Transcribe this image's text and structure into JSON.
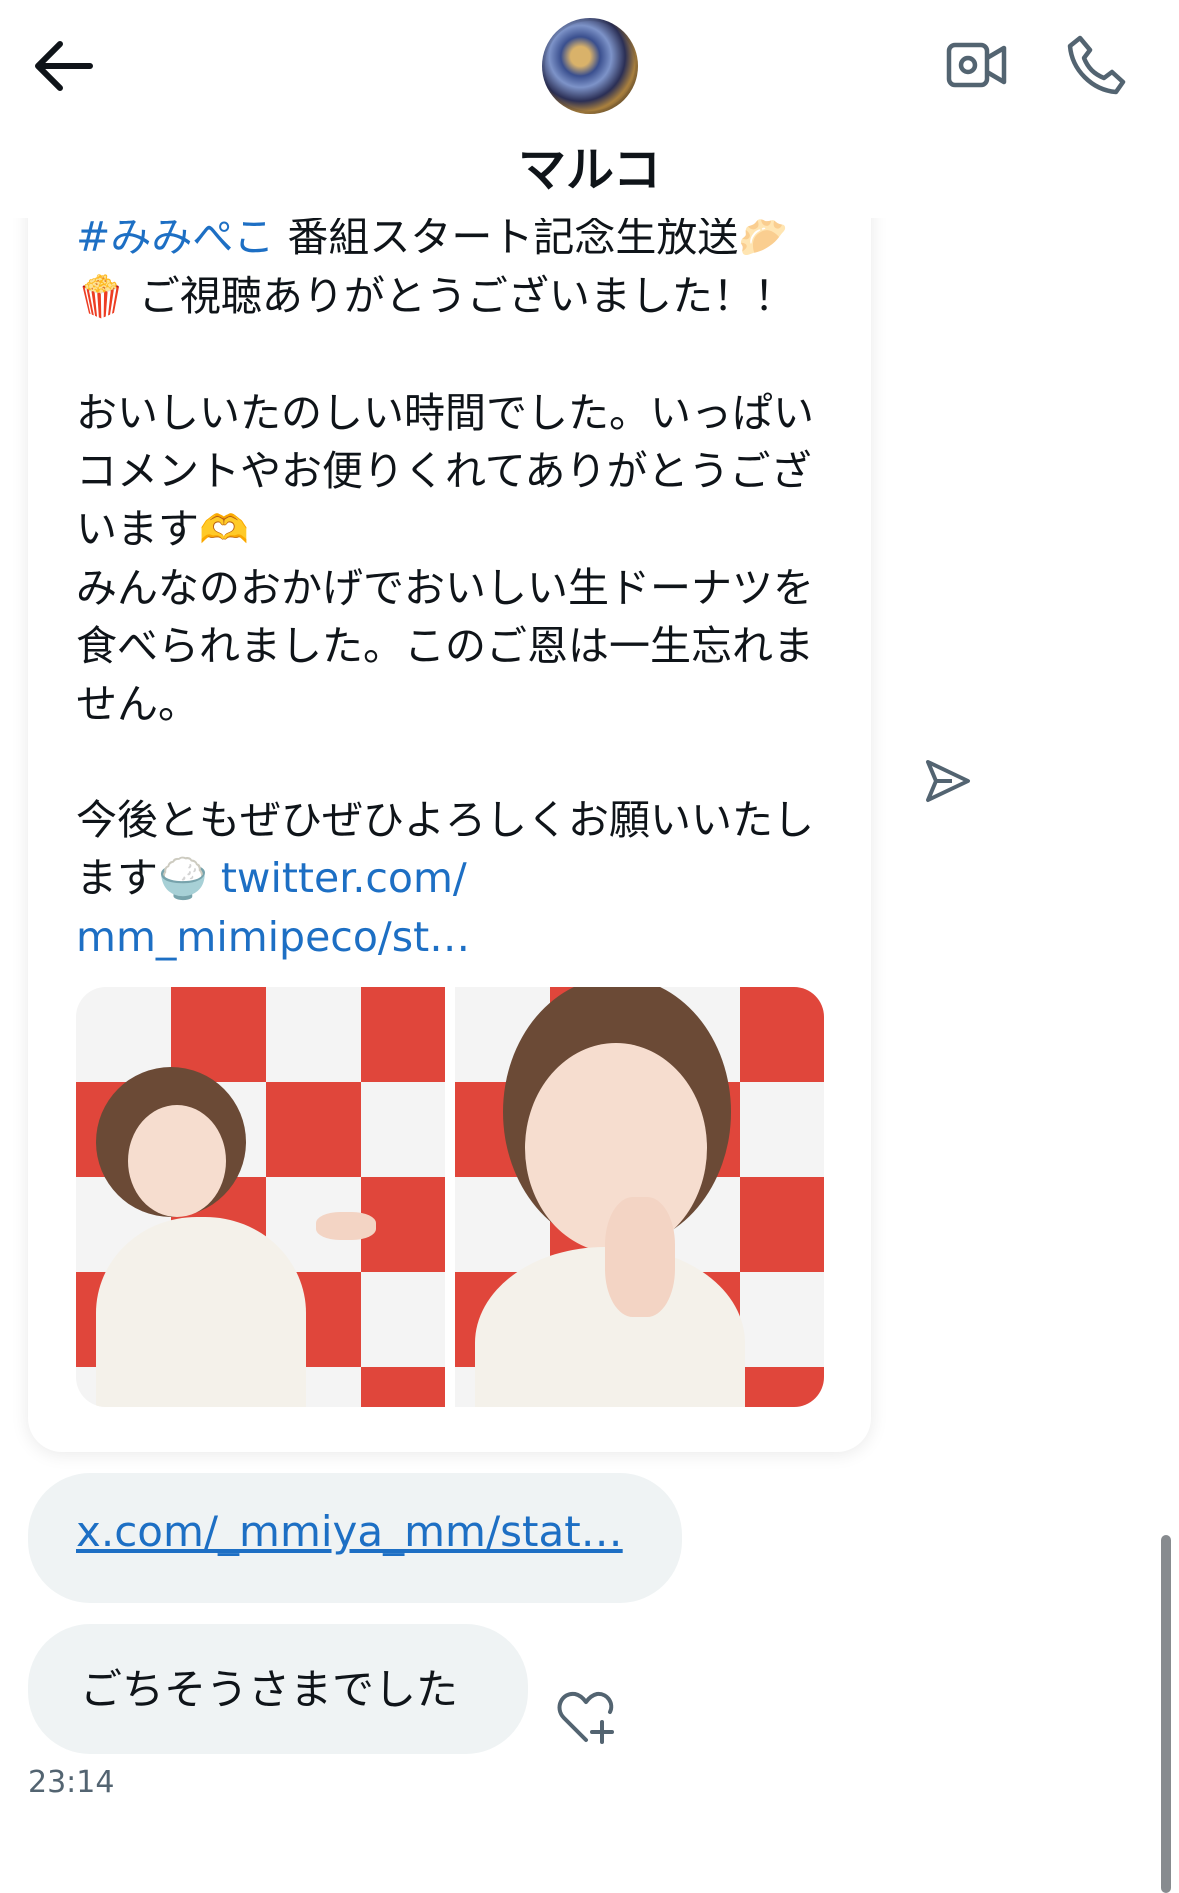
{
  "header": {
    "contact_name": "マルコ",
    "back_icon": "arrow-left-icon",
    "video_icon": "video-call-icon",
    "phone_icon": "phone-call-icon"
  },
  "tweet": {
    "hashtag": "#みみぺこ",
    "line1_text": " 番組スタート記念生放送",
    "line1_emoji": "🥟",
    "line2_emoji": "🍿",
    "line2_text": " ご視聴ありがとうございました！！",
    "para1_a": "おいしいたのしい時間でした。いっぱいコメントやお便りくれてありがとうございます",
    "para1_emoji": "🫶",
    "para1_b": "みんなのおかげでおいしい生ドーナツを食べられました。このご恩は一生忘れません。",
    "para2": "今後ともぜひぜひよろしくお願いいたします",
    "para2_emoji": "🍚",
    "link_part1": "twitter.com/",
    "link_part2": "mm_mimipeco/st…",
    "photos": [
      "photo-1",
      "photo-2"
    ]
  },
  "messages": [
    {
      "type": "link",
      "text": "x.com/_mmiya_mm/stat…"
    },
    {
      "type": "text",
      "text": "ごちそうさまでした"
    }
  ],
  "timestamp": "23:14",
  "colors": {
    "link": "#1d6fc4",
    "bubble": "#eff3f4",
    "icon": "#536471",
    "studio_red": "#e0463b"
  }
}
